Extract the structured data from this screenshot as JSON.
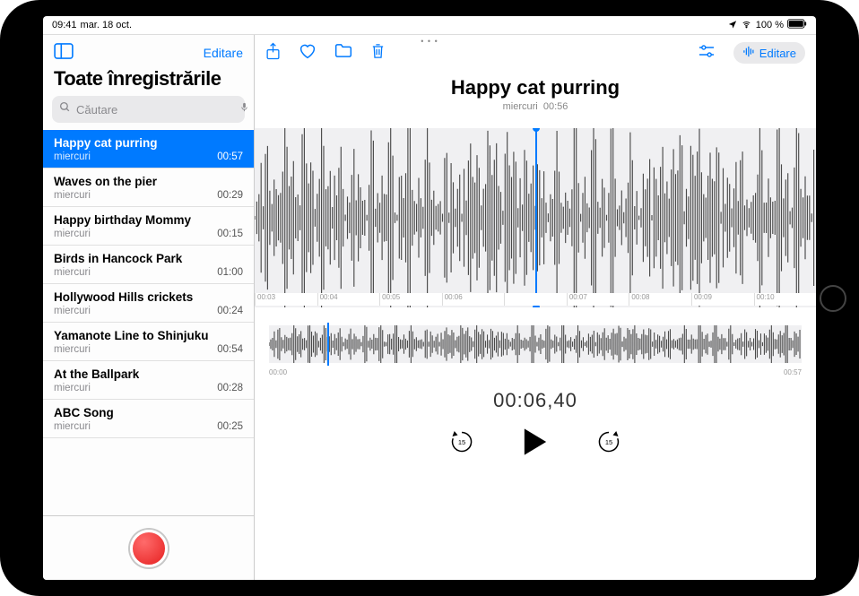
{
  "status": {
    "time": "09:41",
    "date": "mar. 18 oct.",
    "battery": "100 %",
    "signal_icon": "location-icon",
    "wifi": true
  },
  "sidebar": {
    "edit_label": "Editare",
    "title": "Toate înregistrările",
    "search_placeholder": "Căutare"
  },
  "recordings": [
    {
      "title": "Happy cat purring",
      "day": "miercuri",
      "duration": "00:57",
      "selected": true
    },
    {
      "title": "Waves on the pier",
      "day": "miercuri",
      "duration": "00:29",
      "selected": false
    },
    {
      "title": "Happy birthday Mommy",
      "day": "miercuri",
      "duration": "00:15",
      "selected": false
    },
    {
      "title": "Birds in Hancock Park",
      "day": "miercuri",
      "duration": "01:00",
      "selected": false
    },
    {
      "title": "Hollywood Hills crickets",
      "day": "miercuri",
      "duration": "00:24",
      "selected": false
    },
    {
      "title": "Yamanote Line to Shinjuku",
      "day": "miercuri",
      "duration": "00:54",
      "selected": false
    },
    {
      "title": "At the Ballpark",
      "day": "miercuri",
      "duration": "00:28",
      "selected": false
    },
    {
      "title": "ABC Song",
      "day": "miercuri",
      "duration": "00:25",
      "selected": false
    }
  ],
  "detail": {
    "title": "Happy cat purring",
    "day": "miercuri",
    "total_duration": "00:56",
    "current_time": "00:06,40",
    "overview_start": "00:00",
    "overview_end": "00:57",
    "overview_cursor_percent": 11,
    "zoom_ticks": [
      "00:03",
      "00:04",
      "00:05",
      "00:06",
      "",
      "00:07",
      "00:08",
      "00:09",
      "00:10"
    ]
  },
  "toolbar": {
    "edit_label": "Editare"
  },
  "icons": {
    "sidebar_toggle": "sidebar-toggle-icon",
    "share": "share-icon",
    "heart": "heart-icon",
    "folder": "folder-icon",
    "trash": "trash-icon",
    "sliders": "sliders-icon",
    "waveform": "waveform-icon",
    "mic": "mic-icon",
    "search": "search-icon",
    "play": "play-icon",
    "back15": "back-15-icon",
    "fwd15": "forward-15-icon",
    "record": "record-icon"
  }
}
